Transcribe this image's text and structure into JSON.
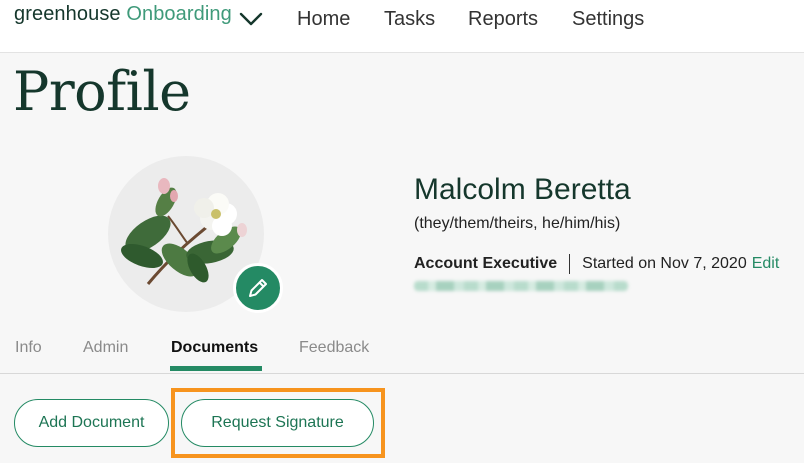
{
  "header": {
    "brand_primary": "greenhouse",
    "brand_secondary": "Onboarding",
    "nav": [
      "Home",
      "Tasks",
      "Reports",
      "Settings"
    ]
  },
  "page": {
    "title": "Profile"
  },
  "profile": {
    "name": "Malcolm Beretta",
    "pronouns": "(they/them/theirs, he/him/his)",
    "job_title": "Account Executive",
    "start_date": "Started on Nov 7, 2020",
    "edit_label": "Edit"
  },
  "tabs": [
    {
      "label": "Info",
      "active": false
    },
    {
      "label": "Admin",
      "active": false
    },
    {
      "label": "Documents",
      "active": true
    },
    {
      "label": "Feedback",
      "active": false
    }
  ],
  "actions": {
    "add_document": "Add Document",
    "request_signature": "Request Signature"
  },
  "colors": {
    "brand_dark": "#15372c",
    "brand_green": "#248a64",
    "highlight_orange": "#f7941e"
  },
  "icons": {
    "logo_dropdown": "chevron-down-icon",
    "avatar_edit": "pencil-icon"
  }
}
